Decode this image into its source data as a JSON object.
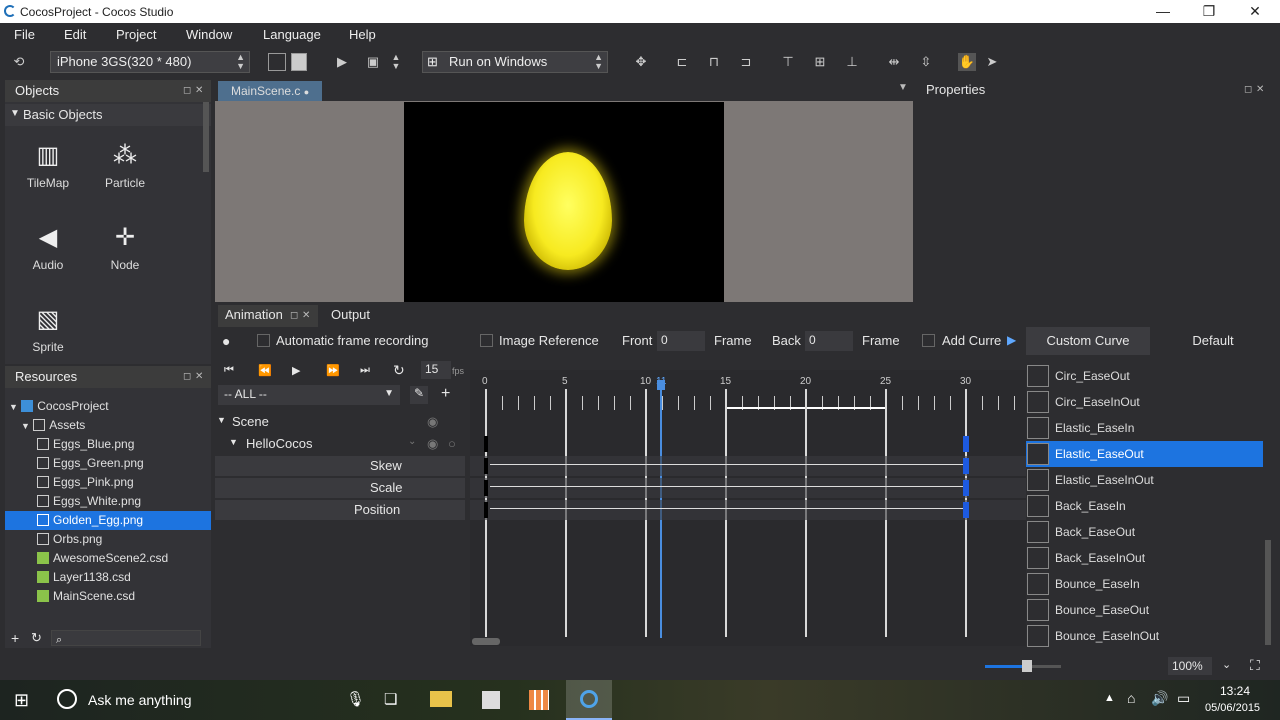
{
  "window": {
    "title": "CocosProject - Cocos Studio",
    "min": "—",
    "max": "❐",
    "close": "✕"
  },
  "menu": [
    "File",
    "Edit",
    "Project",
    "Window",
    "Language",
    "Help"
  ],
  "toolbar": {
    "device": "iPhone 3GS(320 * 480)",
    "run_target": "Run on Windows"
  },
  "objects": {
    "title": "Objects",
    "section": "Basic Objects",
    "items": [
      {
        "label": "TileMap",
        "icon": "map-icon"
      },
      {
        "label": "Particle",
        "icon": "particle-icon"
      },
      {
        "label": "Audio",
        "icon": "speaker-icon"
      },
      {
        "label": "Node",
        "icon": "node-icon"
      },
      {
        "label": "Sprite",
        "icon": "image-icon"
      }
    ]
  },
  "resources": {
    "title": "Resources",
    "tree": [
      {
        "label": "CocosProject",
        "type": "project"
      },
      {
        "label": "Assets",
        "type": "folder"
      },
      {
        "label": "Eggs_Blue.png",
        "type": "png"
      },
      {
        "label": "Eggs_Green.png",
        "type": "png"
      },
      {
        "label": "Eggs_Pink.png",
        "type": "png"
      },
      {
        "label": "Eggs_White.png",
        "type": "png"
      },
      {
        "label": "Golden_Egg.png",
        "type": "png",
        "selected": true
      },
      {
        "label": "Orbs.png",
        "type": "png"
      },
      {
        "label": "AwesomeScene2.csd",
        "type": "csd"
      },
      {
        "label": "Layer1138.csd",
        "type": "csd"
      },
      {
        "label": "MainScene.csd",
        "type": "csd"
      }
    ]
  },
  "editor": {
    "tab": "MainScene.c"
  },
  "properties": {
    "title": "Properties"
  },
  "animation": {
    "tabs": [
      "Animation",
      "Output"
    ],
    "auto_record": "Automatic frame recording",
    "image_ref": "Image Reference",
    "front_label": "Front",
    "front_value": "0",
    "frame_label": "Frame",
    "back_label": "Back",
    "back_value": "0",
    "add_curve": "Add Curre",
    "fps_value": "15",
    "fps_unit": "fps",
    "filter": "-- ALL --",
    "ticks": [
      "0",
      "5",
      "10",
      "11",
      "15",
      "20",
      "25",
      "30"
    ],
    "tracks": {
      "scene": "Scene",
      "node": "HelloCocos",
      "props": [
        "Skew",
        "Scale",
        "Position"
      ]
    }
  },
  "curves": {
    "tab_custom": "Custom Curve",
    "tab_default": "Default",
    "items": [
      "Circ_EaseOut",
      "Circ_EaseInOut",
      "Elastic_EaseIn",
      "Elastic_EaseOut",
      "Elastic_EaseInOut",
      "Back_EaseIn",
      "Back_EaseOut",
      "Back_EaseInOut",
      "Bounce_EaseIn",
      "Bounce_EaseOut",
      "Bounce_EaseInOut"
    ],
    "selected": "Elastic_EaseOut"
  },
  "status": {
    "zoom": "100%"
  },
  "taskbar": {
    "search": "Ask me anything",
    "time": "13:24",
    "date": "05/06/2015"
  }
}
